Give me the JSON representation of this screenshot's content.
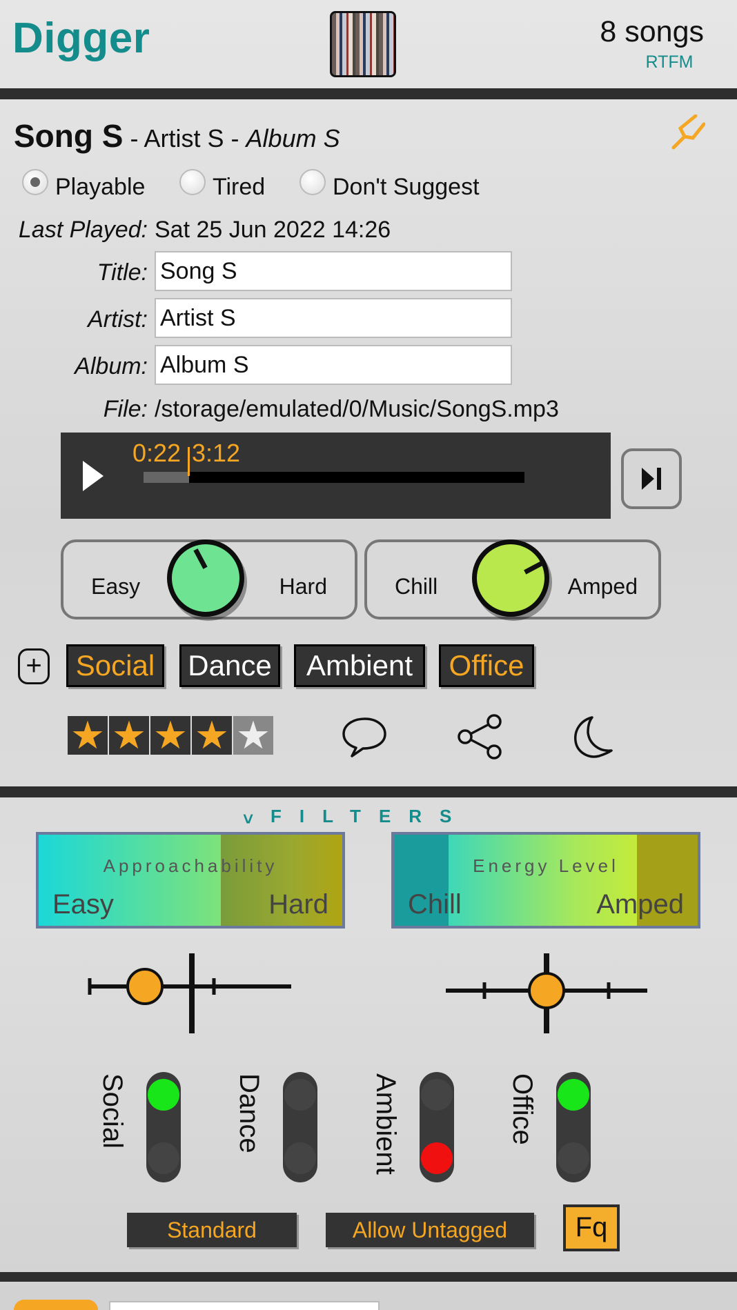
{
  "header": {
    "title": "Digger",
    "song_count": "8 songs",
    "help_link": "RTFM"
  },
  "song": {
    "title": "Song S",
    "sep1": "-",
    "artist": "Artist S",
    "sep2": "-",
    "album": "Album S",
    "status_options": [
      "Playable",
      "Tired",
      "Don't Suggest"
    ],
    "status_selected": "Playable",
    "last_played_label": "Last Played:",
    "last_played": "Sat 25 Jun 2022 14:26",
    "title_label": "Title:",
    "artist_label": "Artist:",
    "album_label": "Album:",
    "file_label": "File:",
    "file_path": "/storage/emulated/0/Music/SongS.mp3"
  },
  "player": {
    "position": "0:22",
    "duration": "3:12",
    "progress": 0.115
  },
  "knobs": [
    {
      "left": "Easy",
      "right": "Hard",
      "color": "#6ee391"
    },
    {
      "left": "Chill",
      "right": "Amped",
      "color": "#b9e84d"
    }
  ],
  "tags": [
    {
      "label": "Social",
      "active": true
    },
    {
      "label": "Dance",
      "active": false
    },
    {
      "label": "Ambient",
      "active": false
    },
    {
      "label": "Office",
      "active": true
    }
  ],
  "rating": {
    "value": 4,
    "max": 5
  },
  "filters": {
    "title": "FILTERS",
    "toggle_glyph": "˅",
    "boxes": [
      {
        "title": "Approachability",
        "left": "Easy",
        "right": "Hard"
      },
      {
        "title": "Energy Level",
        "left": "Chill",
        "right": "Amped"
      }
    ],
    "tag_filters": [
      {
        "label": "Social",
        "state": "on"
      },
      {
        "label": "Dance",
        "state": "off"
      },
      {
        "label": "Ambient",
        "state": "excluded"
      },
      {
        "label": "Office",
        "state": "on"
      }
    ],
    "buttons": [
      "Standard",
      "Allow Untagged"
    ],
    "fq_label": "Fq"
  },
  "colors": {
    "accent": "#148c8c",
    "orange": "#f5a623",
    "toggle_on": "#19e619",
    "toggle_excluded": "#f01010"
  }
}
